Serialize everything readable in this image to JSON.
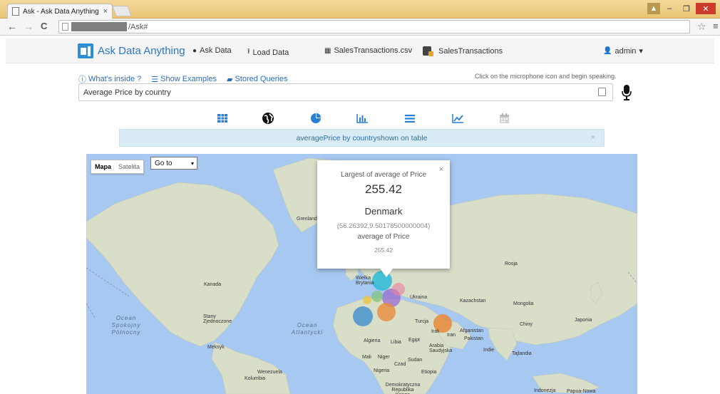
{
  "browser": {
    "tab_title": "Ask - Ask Data Anything",
    "tab_close": "×",
    "url_path": "/Ask#",
    "nav_back": "←",
    "nav_forward": "→",
    "nav_reload": "C",
    "star": "☆",
    "menu": "≡",
    "win_minimize": "–",
    "win_maximize": "❐",
    "win_close": "✕"
  },
  "navbar": {
    "brand": "Ask Data Anything",
    "ask_data": "Ask Data",
    "load_data": "Load Data",
    "file": "SalesTransactions.csv",
    "dataset": "SalesTransactions",
    "user": "admin",
    "user_caret": "▾"
  },
  "query": {
    "whats_inside": "What's inside ?",
    "show_examples": "Show Examples",
    "stored_queries": "Stored Queries",
    "mic_hint": "Click on the microphone icon and begin speaking.",
    "value": "Average Price by country"
  },
  "views": [
    "table-icon",
    "globe-icon",
    "pie-icon",
    "bar-chart-icon",
    "list-icon",
    "line-chart-icon",
    "calendar-icon"
  ],
  "alert": {
    "text_prefix": "average ",
    "link": "Price by country",
    "text_suffix": " shown on table",
    "close": "×"
  },
  "map": {
    "type_map": "Mapa",
    "type_satellite": "Satelita",
    "goto": "Go to",
    "goto_caret": "▾",
    "labels": {
      "greenland": "Grenlandia",
      "canada": "Kanada",
      "usa": "Stany Zjednoczone",
      "mexico": "Meksyk",
      "venezuela": "Wenezuela",
      "colombia": "Kolumbia",
      "uk": "Wielka Brytania",
      "ukraine": "Ukraina",
      "kazakhstan": "Kazachstan",
      "mongolia": "Mongolia",
      "china": "Chiny",
      "japan": "Japonia",
      "russia": "Rosja",
      "turkey": "Turcja",
      "iraq": "Irak",
      "iran": "Iran",
      "afghanistan": "Afganistan",
      "pakistan": "Pakistan",
      "india": "Indie",
      "thailand": "Tajlandia",
      "algeria": "Algieria",
      "libya": "Libia",
      "egypt": "Egipt",
      "saudi": "Arabia Saudyjska",
      "mali": "Mali",
      "niger": "Niger",
      "chad": "Czad",
      "sudan": "Sudan",
      "nigeria": "Nigeria",
      "ethiopia": "Etiopia",
      "drc": "Demokratyczna Republika Konga",
      "indonesia": "Indonezja",
      "png": "Papua-Nowa"
    },
    "ocean_pacific": "Ocean Spokojny Północny",
    "ocean_atlantic": "Ocean Atlantycki",
    "bubble_colors": [
      "#2bbbd8",
      "#9b72cf",
      "#e88a3a",
      "#3f8fd0",
      "#f0c030",
      "#e77fa0",
      "#7cc576"
    ]
  },
  "infowindow": {
    "title": "Largest of average of Price",
    "value": "255.42",
    "country": "Denmark",
    "coords": "(56.26392,9.50178500000004)",
    "measure": "average of Price",
    "measure_value": "255.42",
    "close": "×"
  }
}
